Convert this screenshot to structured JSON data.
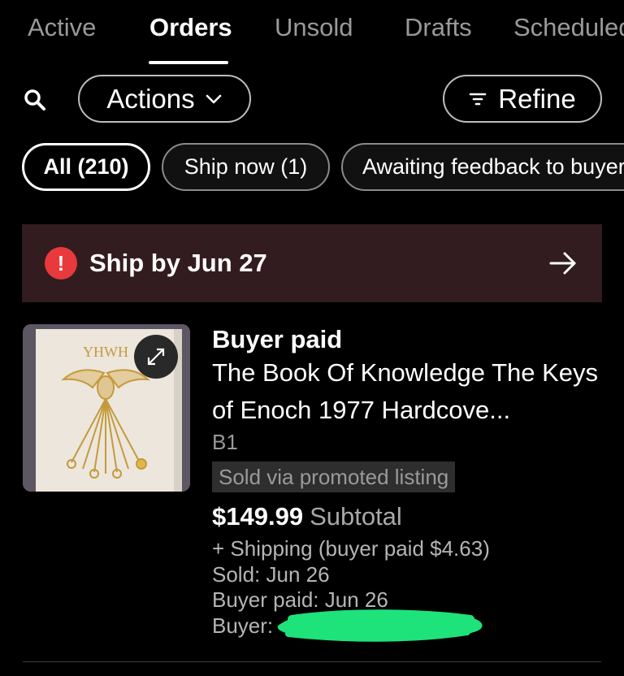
{
  "tabs": [
    {
      "label": "Active"
    },
    {
      "label": "Orders"
    },
    {
      "label": "Unsold"
    },
    {
      "label": "Drafts"
    },
    {
      "label": "Scheduled"
    }
  ],
  "toolbar": {
    "actions_label": "Actions",
    "refine_label": "Refine",
    "search_icon": "search-icon",
    "filter_icon": "filter-icon"
  },
  "filters": [
    {
      "label": "All (210)",
      "selected": true
    },
    {
      "label": "Ship now (1)",
      "selected": false
    },
    {
      "label": "Awaiting feedback to buyer",
      "selected": false
    }
  ],
  "banner": {
    "icon": "alert-icon",
    "text": "Ship by Jun 27",
    "color": "#331c1f",
    "icon_color": "#e8393c"
  },
  "order": {
    "status": "Buyer paid",
    "title": "The Book Of Knowledge The Keys of Enoch 1977 Hardcove...",
    "sku": "B1",
    "promo": "Sold via promoted listing",
    "price": "$149.99",
    "subtotal_label": "Subtotal",
    "shipping": "+ Shipping (buyer paid $4.63)",
    "sold": "Sold: Jun 26",
    "buyer_paid": "Buyer paid: Jun 26",
    "buyer_label": "Buyer:",
    "thumb_text": "YHWH"
  }
}
